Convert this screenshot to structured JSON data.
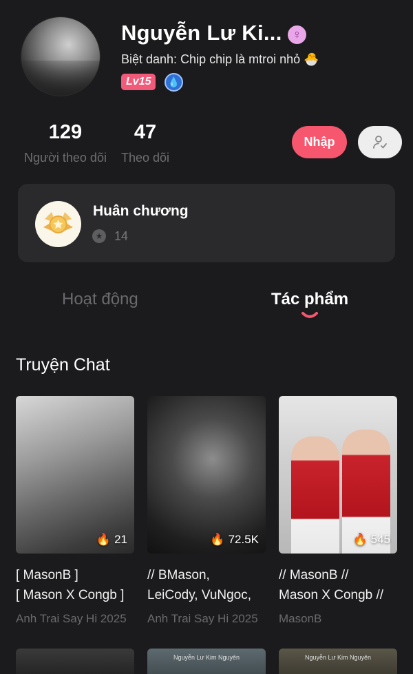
{
  "profile": {
    "name": "Nguyễn Lư Ki...",
    "gender_symbol": "♀",
    "nickname": "Biệt danh: Chip chip là mtroi nhỏ 🐣",
    "level": "Lv15"
  },
  "stats": {
    "followers_value": "129",
    "followers_label": "Người theo dõi",
    "following_value": "47",
    "following_label": "Theo dõi"
  },
  "actions": {
    "join_label": "Nhập"
  },
  "medal": {
    "title": "Huân chương",
    "count": "14"
  },
  "tabs": [
    {
      "label": "Hoạt động",
      "active": false
    },
    {
      "label": "Tác phẩm",
      "active": true
    }
  ],
  "section": {
    "title": "Truyện Chat"
  },
  "stories": [
    {
      "count": "21",
      "title_line1": "[ MasonB ]",
      "title_line2": "[ Mason X Congb ]",
      "subtitle": "Anh Trai Say Hi 2025"
    },
    {
      "count": "72.5K",
      "title_line1": "// BMason,",
      "title_line2": "LeiCody, VuNgoc,",
      "subtitle": "Anh Trai Say Hi 2025"
    },
    {
      "count": "545",
      "title_line1": "// MasonB //",
      "title_line2": "Mason X Congb //",
      "subtitle": "MasonB"
    }
  ],
  "peek_covers": [
    {
      "text": ""
    },
    {
      "text": "Nguyễn Lư Kim Nguyên"
    },
    {
      "text": "Nguyễn Lư Kim Nguyên"
    }
  ],
  "colors": {
    "background": "#1b1b1d",
    "accent": "#f6576f",
    "card": "#2a2a2c",
    "muted": "#6e6e72"
  }
}
